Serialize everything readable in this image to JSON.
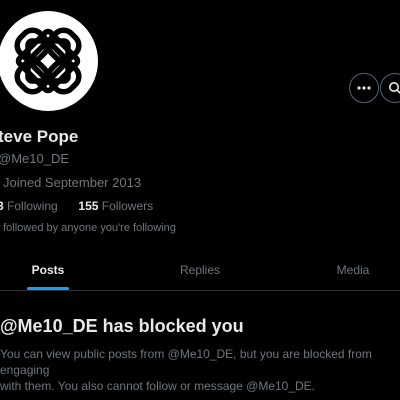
{
  "profile": {
    "display_name": "teve Pope",
    "handle": "Me10_DE",
    "joined": "Joined September 2013",
    "following_count": "3",
    "following_label": "Following",
    "followers_count": "155",
    "followers_label": "Followers",
    "followed_by": "t followed by anyone you're following",
    "avatar_icon": "celtic-knot-logo"
  },
  "actions": {
    "more_icon": "more-horizontal-icon",
    "search_icon": "search-icon"
  },
  "tabs": [
    {
      "label": "Posts",
      "active": true
    },
    {
      "label": "Replies",
      "active": false
    },
    {
      "label": "Media",
      "active": false
    }
  ],
  "blocked": {
    "title": "@Me10_DE has blocked you",
    "line1": "You can view public posts from @Me10_DE, but you are blocked from engaging",
    "line2": "with them. You also cannot follow or message @Me10_DE."
  },
  "colors": {
    "background": "#000000",
    "text_primary": "#e7e9ea",
    "text_secondary": "#71767b",
    "accent": "#1d9bf0",
    "divider": "#2f3336"
  }
}
